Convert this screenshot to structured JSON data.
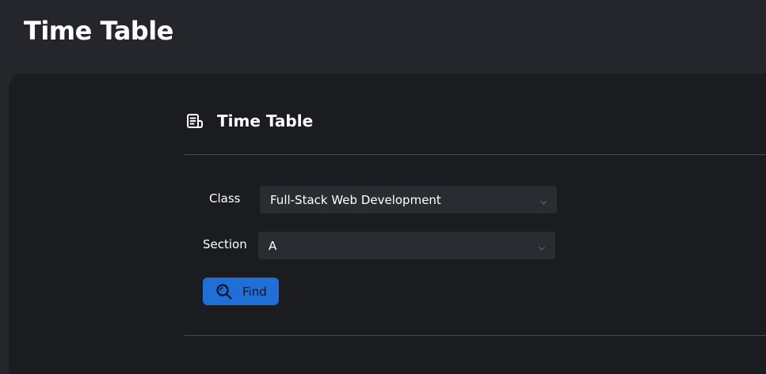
{
  "header": {
    "title": "Time Table"
  },
  "card": {
    "title": "Time Table",
    "icon": "document-list-icon"
  },
  "form": {
    "class_label": "Class",
    "class_value": "Full-Stack Web Development",
    "section_label": "Section",
    "section_value": "A",
    "find_label": "Find",
    "find_icon": "search-icon"
  },
  "colors": {
    "background": "#25262b",
    "panel": "#1b1c20",
    "select_bg": "#2b2c31",
    "accent": "#1f6fd6"
  }
}
